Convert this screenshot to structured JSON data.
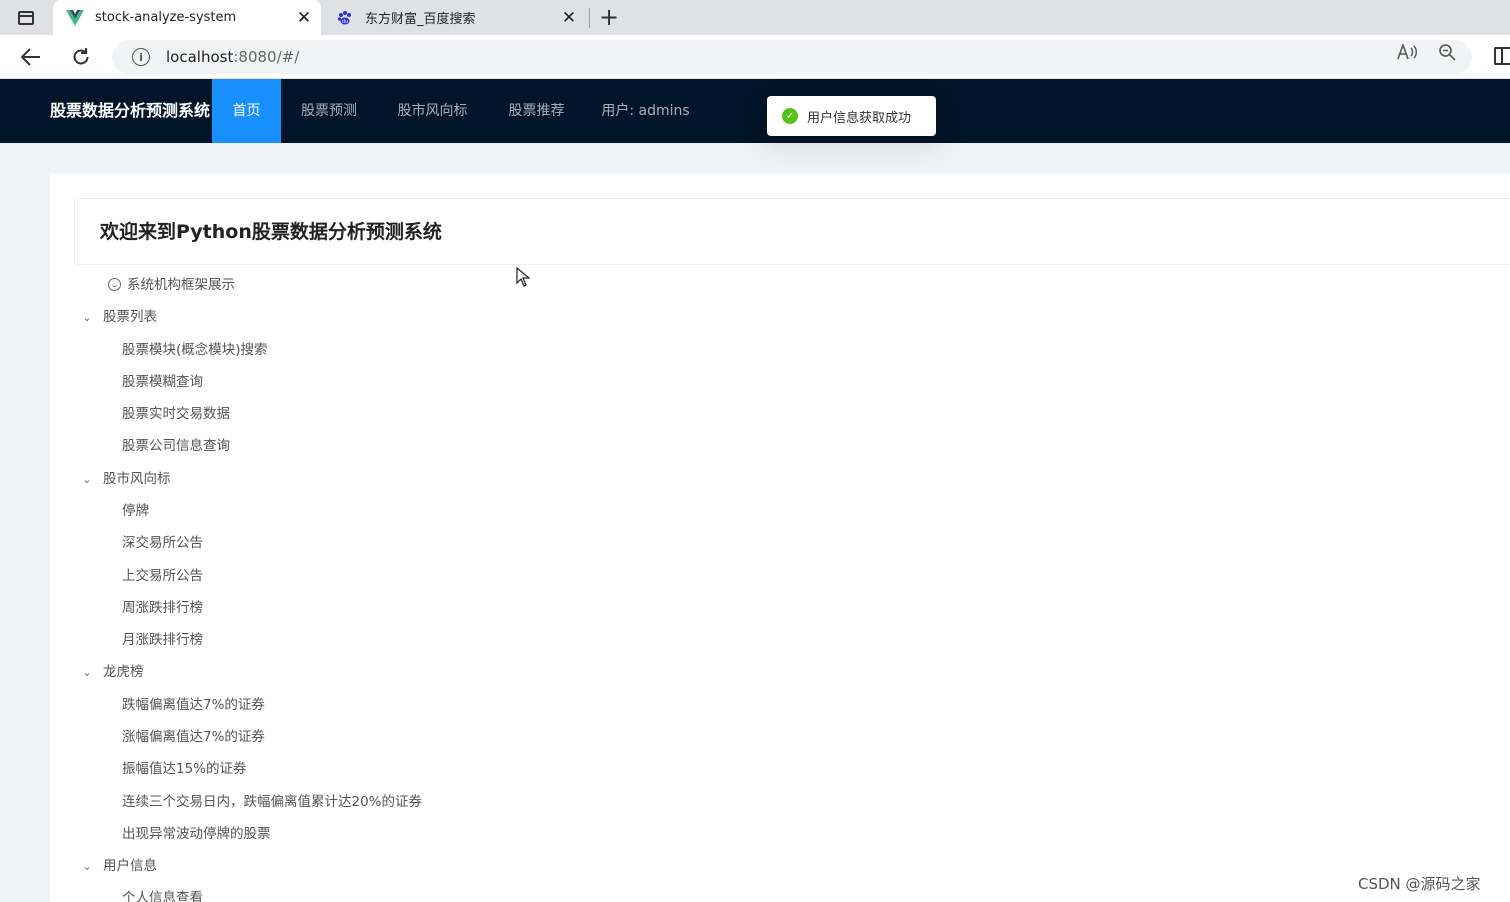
{
  "browser": {
    "tabs": [
      {
        "title": "stock-analyze-system",
        "active": true,
        "favicon": "vue-icon"
      },
      {
        "title": "东方财富_百度搜索",
        "active": false,
        "favicon": "baidu-paw-icon"
      }
    ],
    "url_host": "localhost",
    "url_rest": ":8080/#/"
  },
  "app": {
    "logo": "股票数据分析预测系统",
    "menu": [
      {
        "label": "首页",
        "selected": true
      },
      {
        "label": "股票预测"
      },
      {
        "label": "股市风向标"
      },
      {
        "label": "股票推荐"
      },
      {
        "label": "用户: admins"
      }
    ],
    "toast": "用户信息获取成功",
    "accent_color": "#1890ff",
    "header_bg": "#001529"
  },
  "welcome": {
    "title": "欢迎来到Python股票数据分析预测系统"
  },
  "tree": {
    "root": "系统机构框架展示",
    "groups": [
      {
        "label": "股票列表",
        "children": [
          "股票模块(概念模块)搜索",
          "股票模糊查询",
          "股票实时交易数据",
          "股票公司信息查询"
        ]
      },
      {
        "label": "股市风向标",
        "children": [
          "停牌",
          "深交易所公告",
          "上交易所公告",
          "周涨跌排行榜",
          "月涨跌排行榜"
        ]
      },
      {
        "label": "龙虎榜",
        "children": [
          "跌幅偏离值达7%的证券",
          "涨幅偏离值达7%的证券",
          "振幅值达15%的证券",
          "连续三个交易日内，跌幅偏离值累计达20%的证券",
          "出现异常波动停牌的股票"
        ]
      },
      {
        "label": "用户信息",
        "children": [
          "个人信息查看"
        ]
      }
    ]
  },
  "watermark": "CSDN @源码之家"
}
